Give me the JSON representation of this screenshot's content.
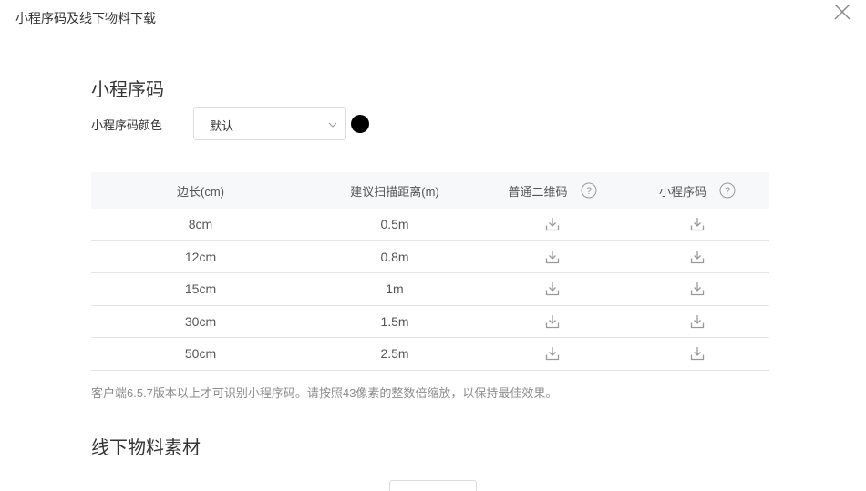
{
  "dialog": {
    "title": "小程序码及线下物料下载"
  },
  "qrcode_section": {
    "title": "小程序码",
    "color_label": "小程序码颜色",
    "color_select_value": "默认",
    "swatch_color": "#000000"
  },
  "table": {
    "headers": [
      "边长(cm)",
      "建议扫描距离(m)",
      "普通二维码",
      "小程序码"
    ],
    "rows": [
      {
        "side": "8cm",
        "distance": "0.5m"
      },
      {
        "side": "12cm",
        "distance": "0.8m"
      },
      {
        "side": "15cm",
        "distance": "1m"
      },
      {
        "side": "30cm",
        "distance": "1.5m"
      },
      {
        "side": "50cm",
        "distance": "2.5m"
      }
    ]
  },
  "note": "客户端6.5.7版本以上才可识别小程序码。请按照43像素的整数倍缩放，以保持最佳效果。",
  "offline_section": {
    "title": "线下物料素材"
  },
  "icons": {
    "close": "close-icon",
    "chevron": "chevron-down-icon",
    "help": "help-circle-icon",
    "download": "download-icon"
  }
}
